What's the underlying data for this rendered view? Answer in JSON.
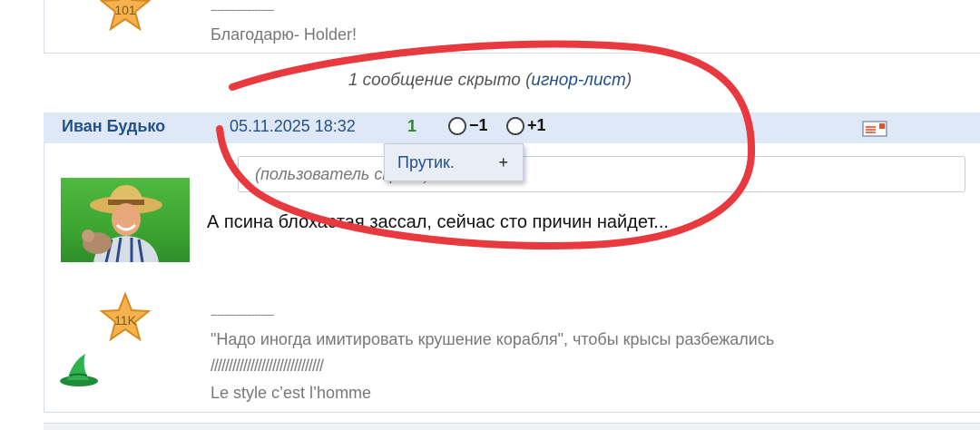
{
  "top_post": {
    "star_count": "101",
    "signature_dashes": "-------------------",
    "signature_text": "Благодарю- Holder!"
  },
  "hidden_notice": {
    "prefix": "1 сообщение скрыто (",
    "link": "игнор-лист",
    "suffix": ")"
  },
  "post": {
    "author": "Иван Будько",
    "date": "05.11.2025 18:32",
    "rating": "1",
    "vote_minus": "−1",
    "vote_plus": "+1",
    "quote_placeholder": "(пользователь скрыт)",
    "popup_label": "Прутик.",
    "popup_plus": "+",
    "message": "А псина блохастая зассал, сейчас сто причин найдет...",
    "star_count": "11K",
    "signature_dashes": "-------------------",
    "signature_quote": "\"Надо иногда имитировать крушение корабля\", чтобы крысы разбежались",
    "signature_slashes": "///////////////////////////////",
    "signature_motto": "Le style c’est l’homme"
  },
  "colors": {
    "header_bg": "#dfe8f6",
    "link": "#24508a",
    "rating_green": "#2b8a2b",
    "scribble_red": "#e8393e"
  },
  "icons": [
    "star-icon",
    "pm-icon",
    "wizard-hat-icon"
  ]
}
